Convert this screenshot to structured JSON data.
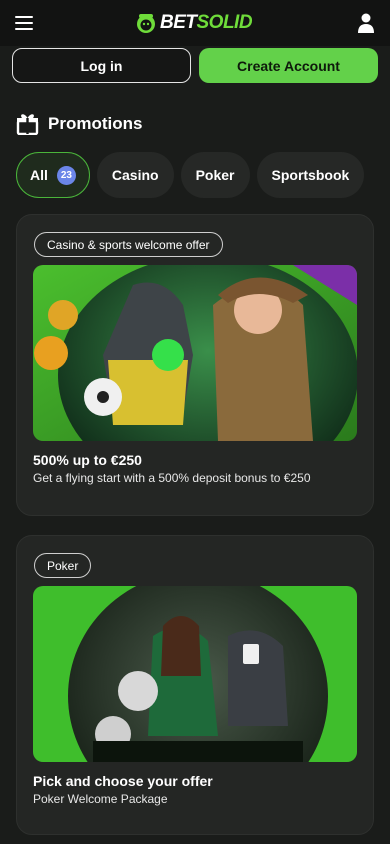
{
  "brand": {
    "part1": "BET",
    "part2": "SOLID",
    "accent": "#63d14a"
  },
  "header": {
    "menu_icon": "hamburger-icon",
    "account_icon": "user-icon"
  },
  "auth": {
    "login_label": "Log in",
    "create_label": "Create Account"
  },
  "promotions": {
    "title": "Promotions",
    "icon": "gift-icon",
    "filters": [
      {
        "label": "All",
        "count": "23",
        "active": true
      },
      {
        "label": "Casino"
      },
      {
        "label": "Poker"
      },
      {
        "label": "Sportsbook"
      }
    ],
    "cards": [
      {
        "tag": "Casino & sports welcome offer",
        "title": "500% up to €250",
        "subtitle": "Get a flying start with a 500% deposit bonus to €250"
      },
      {
        "tag": "Poker",
        "title": "Pick and choose your offer",
        "subtitle": "Poker Welcome Package"
      }
    ]
  }
}
